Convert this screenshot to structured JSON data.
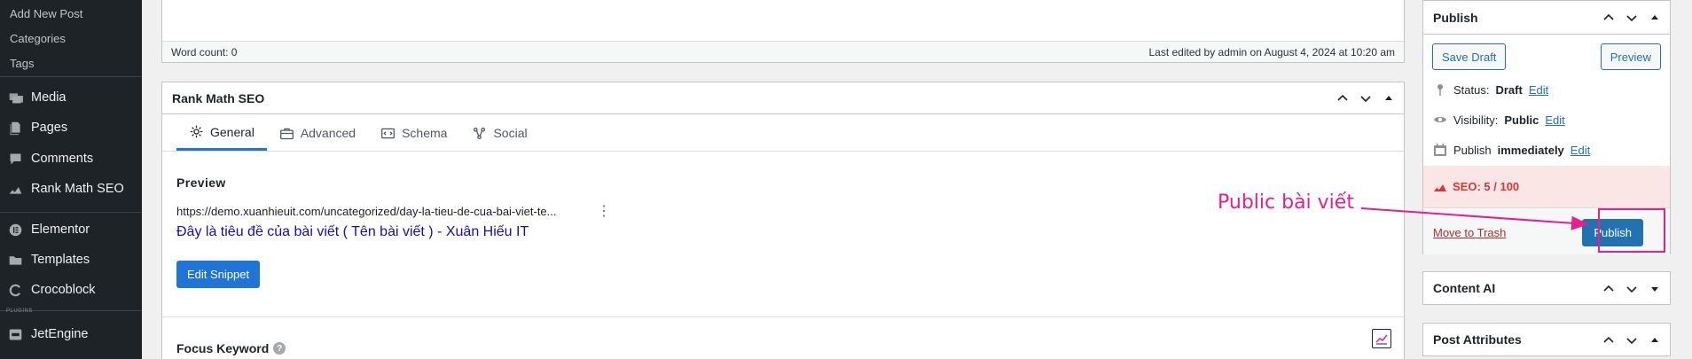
{
  "sidebar": {
    "sub_items": [
      "Add New Post",
      "Categories",
      "Tags"
    ],
    "items": [
      {
        "label": "Media",
        "icon": "media-icon"
      },
      {
        "label": "Pages",
        "icon": "pages-icon"
      },
      {
        "label": "Comments",
        "icon": "comments-icon"
      },
      {
        "label": "Rank Math SEO",
        "icon": "rank-math-icon"
      },
      {
        "label": "Elementor",
        "icon": "elementor-icon"
      },
      {
        "label": "Templates",
        "icon": "templates-icon"
      },
      {
        "label": "Crocoblock",
        "icon": "crocoblock-icon"
      },
      {
        "label": "JetEngine",
        "icon": "jetengine-icon"
      }
    ],
    "plugins_label": "PLUGINS"
  },
  "editor": {
    "word_count": "Word count: 0",
    "last_edited": "Last edited by admin on August 4, 2024 at 10:20 am"
  },
  "rank_math": {
    "title": "Rank Math SEO",
    "tabs": [
      {
        "label": "General",
        "icon": "gear-icon",
        "active": true
      },
      {
        "label": "Advanced",
        "icon": "toolbox-icon",
        "active": false
      },
      {
        "label": "Schema",
        "icon": "schema-icon",
        "active": false
      },
      {
        "label": "Social",
        "icon": "social-icon",
        "active": false
      }
    ],
    "preview_label": "Preview",
    "preview_url": "https://demo.xuanhieuit.com/uncategorized/day-la-tieu-de-cua-bai-viet-te...",
    "preview_title": "Đây là tiêu đề của bài viết ( Tên bài viết ) - Xuân Hiếu IT",
    "edit_snippet": "Edit Snippet",
    "focus_keyword": "Focus Keyword",
    "help": "?"
  },
  "publish": {
    "title": "Publish",
    "save_draft": "Save Draft",
    "preview": "Preview",
    "status_label": "Status:",
    "status_value": "Draft",
    "visibility_label": "Visibility:",
    "visibility_value": "Public",
    "publish_label": "Publish",
    "publish_value": "immediately",
    "edit": "Edit",
    "seo_score": "SEO: 5 / 100",
    "move_to_trash": "Move to Trash",
    "publish_button": "Publish"
  },
  "side_boxes": {
    "content_ai": "Content AI",
    "post_attributes": "Post Attributes"
  },
  "annotation": {
    "text": "Public bài viết",
    "color": "#e91e8c"
  },
  "colors": {
    "accent": "#2271b1",
    "rank_math_blue": "#1f74d6",
    "seo_bad": "#d63638"
  }
}
